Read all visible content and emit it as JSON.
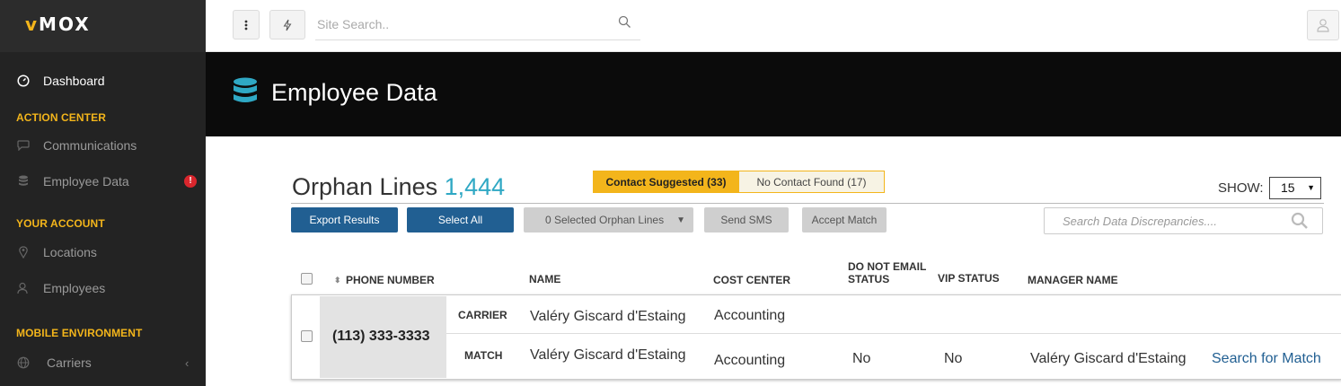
{
  "sidebar": {
    "logo_accent": "v",
    "logo_text": "MOX",
    "dashboard": "Dashboard",
    "section_action_center": "ACTION CENTER",
    "communications": "Communications",
    "employee_data": "Employee Data",
    "alert_badge": "!",
    "section_your_account": "YOUR ACCOUNT",
    "locations": "Locations",
    "employees": "Employees",
    "section_mobile_environment": "MOBILE ENVIRONMENT",
    "carriers": "Carriers"
  },
  "topbar": {
    "menu_icon": "vertical-dots-icon",
    "quick_icon": "lightning-icon",
    "search_placeholder": "Site Search..",
    "user_icon": "user-icon"
  },
  "header": {
    "icon": "database-icon",
    "title": "Employee Data"
  },
  "orphan": {
    "title": "Orphan Lines",
    "count": "1,444",
    "tab_suggested": "Contact Suggested (33)",
    "tab_not_found": "No Contact Found (17)",
    "show_label": "SHOW:",
    "show_value": "15"
  },
  "toolbar": {
    "export": "Export Results",
    "select_all": "Select All",
    "selected": "0 Selected Orphan Lines",
    "send_sms": "Send SMS",
    "accept_match": "Accept Match",
    "search_placeholder": "Search Data Discrepancies...."
  },
  "table": {
    "headers": {
      "phone": "PHONE NUMBER",
      "name": "NAME",
      "cost_center": "COST CENTER",
      "dne_line1": "DO NOT EMAIL",
      "dne_line2": "STATUS",
      "vip": "VIP STATUS",
      "manager": "MANAGER NAME"
    },
    "row": {
      "phone": "(113) 333-3333",
      "carrier_label": "CARRIER",
      "carrier_name": "Valéry Giscard d'Estaing",
      "carrier_cost_center": "Accounting",
      "match_label": "MATCH",
      "match_name": "Valéry Giscard d'Estaing",
      "match_cost_center": "Accounting",
      "match_dne": "No",
      "match_vip": "No",
      "match_manager": "Valéry Giscard d'Estaing",
      "search_link": "Search for Match"
    }
  },
  "colors": {
    "accent": "#f3b51b",
    "primary": "#215f92",
    "count": "#2fa8c4",
    "alert": "#d9262d"
  }
}
